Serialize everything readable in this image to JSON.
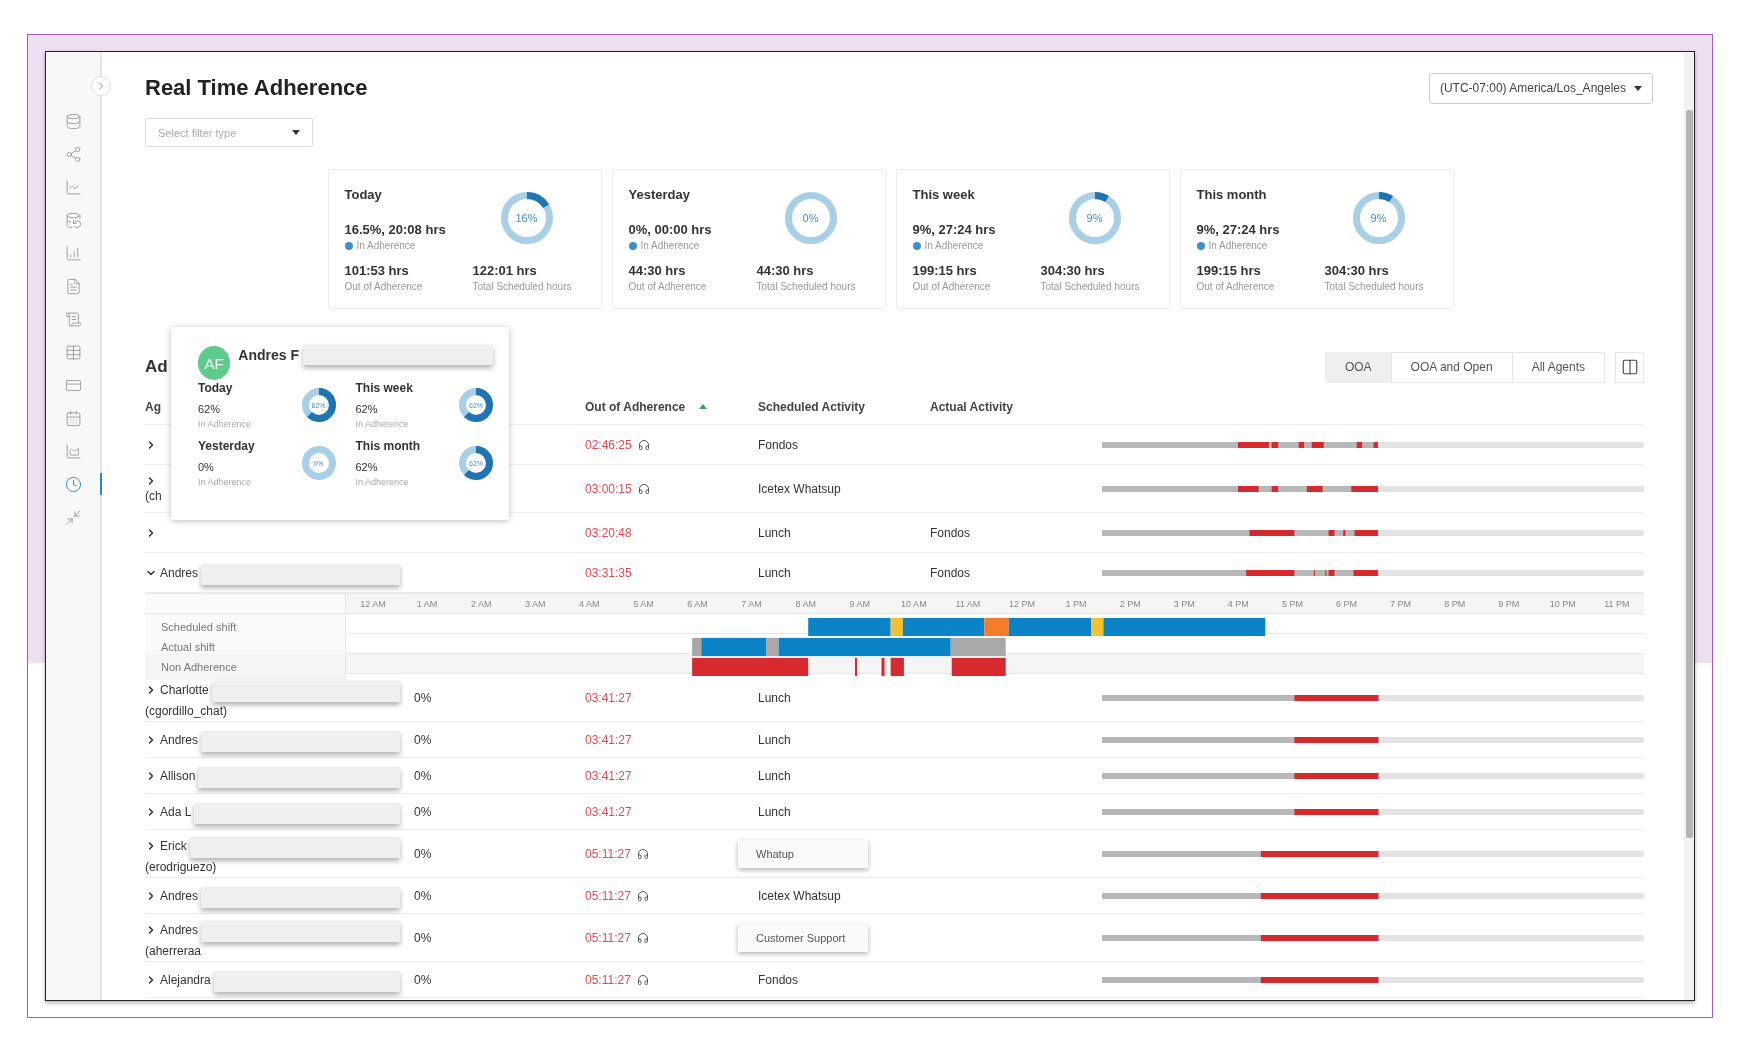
{
  "sidebar": {
    "items": [
      {
        "selected": false
      },
      {
        "selected": false
      },
      {
        "selected": false
      },
      {
        "selected": false
      },
      {
        "selected": false
      },
      {
        "selected": false
      },
      {
        "selected": false
      },
      {
        "selected": false
      },
      {
        "selected": false
      },
      {
        "selected": false
      },
      {
        "selected": false
      },
      {
        "selected": true
      },
      {
        "selected": false
      }
    ]
  },
  "title": "Real Time Adherence",
  "timezone": "(UTC-07:00) America/Los_Angeles",
  "filter": {
    "placeholder": "Select filter type"
  },
  "summary_cards": [
    {
      "label": "Today",
      "percent": "16%",
      "level": 0.16,
      "in_adherence": "16.5%, 20:08 hrs",
      "in_adherence_label": "In Adherence",
      "out": "101:53 hrs",
      "out_label": "Out of Adherence",
      "total": "122:01 hrs",
      "total_label": "Total Scheduled hours"
    },
    {
      "label": "Yesterday",
      "percent": "0%",
      "level": 0,
      "in_adherence": "0%, 00:00 hrs",
      "in_adherence_label": "In Adherence",
      "out": "44:30 hrs",
      "out_label": "Out of Adherence",
      "total": "44:30 hrs",
      "total_label": "Total Scheduled hours"
    },
    {
      "label": "This week",
      "percent": "9%",
      "level": 0.09,
      "in_adherence": "9%, 27:24 hrs",
      "in_adherence_label": "In Adherence",
      "out": "199:15 hrs",
      "out_label": "Out of Adherence",
      "total": "304:30 hrs",
      "total_label": "Total Scheduled hours"
    },
    {
      "label": "This month",
      "percent": "9%",
      "level": 0.09,
      "in_adherence": "9%, 27:24 hrs",
      "in_adherence_label": "In Adherence",
      "out": "199:15 hrs",
      "out_label": "Out of Adherence",
      "total": "304:30 hrs",
      "total_label": "Total Scheduled hours"
    }
  ],
  "section_title": "Ad",
  "view_tabs": [
    {
      "label": "OOA",
      "selected": true
    },
    {
      "label": "OOA and Open",
      "selected": false
    },
    {
      "label": "All Agents",
      "selected": false
    }
  ],
  "table": {
    "columns": [
      {
        "label": "Ag",
        "sorted": false
      },
      {
        "label": "Out of Adherence",
        "sorted": true
      },
      {
        "label": "Scheduled Activity",
        "sorted": false
      },
      {
        "label": "Actual Activity",
        "sorted": false
      }
    ],
    "rows": [
      {
        "expanded": false,
        "redacted": false,
        "out_of_adherence": "02:46:25",
        "on_call": true,
        "scheduled_activity": "Fondos",
        "scheduled_boxed": false
      },
      {
        "expanded": false,
        "redacted": false,
        "login": "(ch",
        "out_of_adherence": "03:00:15",
        "on_call": true,
        "scheduled_activity": "Icetex Whatsup",
        "scheduled_boxed": false
      },
      {
        "expanded": false,
        "redacted": false,
        "out_of_adherence": "03:20:48",
        "on_call": false,
        "scheduled_activity": "Lunch",
        "scheduled_boxed": false,
        "actual_activity": "Fondos"
      },
      {
        "expanded": true,
        "redacted": true,
        "name": "Andres",
        "out_of_adherence": "03:31:35",
        "on_call": false,
        "scheduled_activity": "Lunch",
        "scheduled_boxed": false,
        "actual_activity": "Fondos"
      },
      {
        "expanded": false,
        "redacted": true,
        "name": "Charlotte",
        "login": "(cgordillo_chat)",
        "adherence": "0%",
        "out_of_adherence": "03:41:27",
        "on_call": false,
        "scheduled_activity": "Lunch",
        "scheduled_boxed": false
      },
      {
        "expanded": false,
        "redacted": true,
        "name": "Andres",
        "adherence": "0%",
        "out_of_adherence": "03:41:27",
        "on_call": false,
        "scheduled_activity": "Lunch",
        "scheduled_boxed": false
      },
      {
        "expanded": false,
        "redacted": true,
        "name": "Allison",
        "adherence": "0%",
        "out_of_adherence": "03:41:27",
        "on_call": false,
        "scheduled_activity": "Lunch",
        "scheduled_boxed": false
      },
      {
        "expanded": false,
        "redacted": true,
        "name": "Ada L",
        "adherence": "0%",
        "out_of_adherence": "03:41:27",
        "on_call": false,
        "scheduled_activity": "Lunch",
        "scheduled_boxed": false
      },
      {
        "expanded": false,
        "redacted": true,
        "name": "Erick",
        "login": "(erodriguezo)",
        "adherence": "0%",
        "out_of_adherence": "05:11:27",
        "on_call": true,
        "scheduled_activity": "Whatup",
        "scheduled_boxed": true
      },
      {
        "expanded": false,
        "redacted": true,
        "name": "Andres",
        "adherence": "0%",
        "out_of_adherence": "05:11:27",
        "on_call": true,
        "scheduled_activity": "Icetex Whatsup",
        "scheduled_boxed": false
      },
      {
        "expanded": false,
        "redacted": true,
        "name": "Andres",
        "login": "(aherreraa",
        "adherence": "0%",
        "out_of_adherence": "05:11:27",
        "on_call": true,
        "scheduled_activity": "Customer Support",
        "scheduled_boxed": true
      },
      {
        "expanded": false,
        "redacted": true,
        "name": "Alejandra",
        "adherence": "0%",
        "out_of_adherence": "05:11:27",
        "on_call": true,
        "scheduled_activity": "Fondos",
        "scheduled_boxed": false
      }
    ]
  },
  "timeline": {
    "hours": [
      "12 AM",
      "1 AM",
      "2 AM",
      "3 AM",
      "4 AM",
      "5 AM",
      "6 AM",
      "7 AM",
      "8 AM",
      "9 AM",
      "10 AM",
      "11 AM",
      "12 PM",
      "1 PM",
      "2 PM",
      "3 PM",
      "4 PM",
      "5 PM",
      "6 PM",
      "7 PM",
      "8 PM",
      "9 PM",
      "10 PM",
      "11 PM"
    ],
    "lanes": [
      {
        "kind": "scheduled",
        "label": "Scheduled shift"
      },
      {
        "kind": "actual",
        "label": "Actual shift"
      },
      {
        "kind": "nonadherence",
        "label": "Non Adherence"
      }
    ]
  },
  "agent_popup": {
    "initials": "AF",
    "name": "Andres F",
    "stats": [
      {
        "label": "Today",
        "value": "62%",
        "caption": "In Adherence",
        "percent": "62%",
        "level": 0.62
      },
      {
        "label": "This week",
        "value": "62%",
        "caption": "In Adherence",
        "percent": "62%",
        "level": 0.62
      },
      {
        "label": "Yesterday",
        "value": "0%",
        "caption": "In Adherence",
        "percent": "0%",
        "level": 0
      },
      {
        "label": "This month",
        "value": "62%",
        "caption": "In Adherence",
        "percent": "62%",
        "level": 0.62
      }
    ]
  }
}
